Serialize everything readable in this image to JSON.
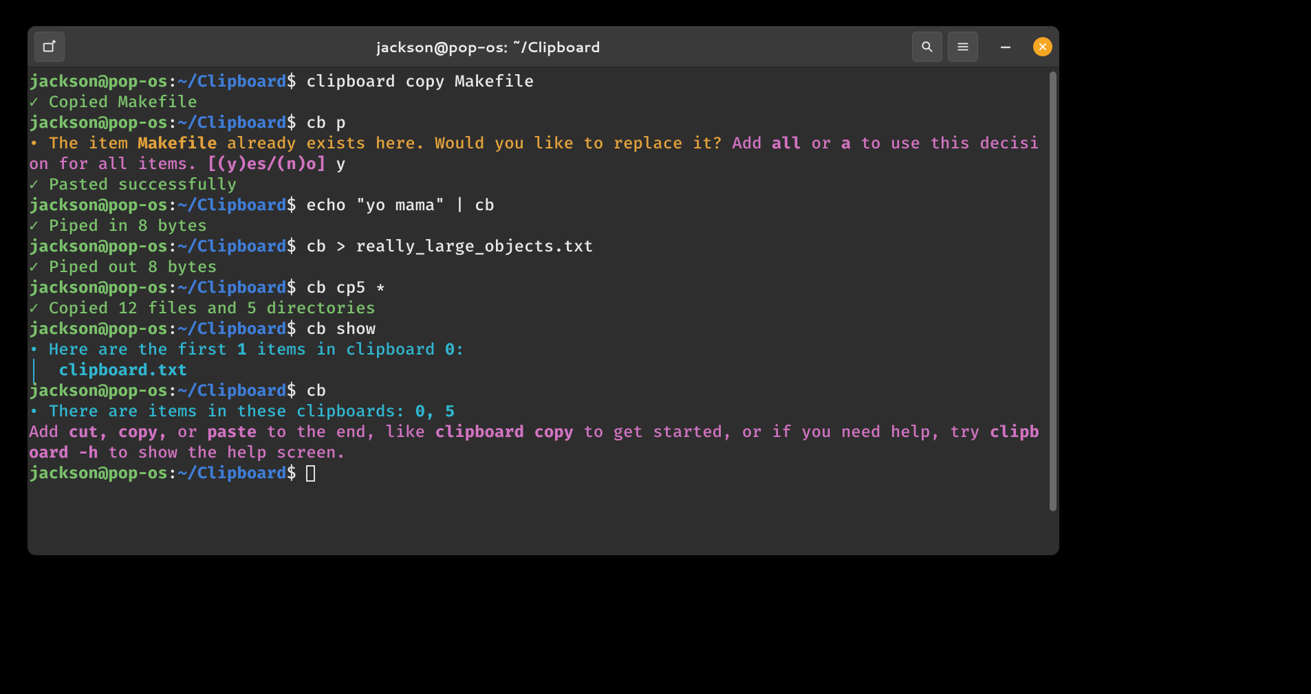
{
  "window": {
    "title": "jackson@pop-os: ~/Clipboard"
  },
  "prompt": {
    "user_host": "jackson@pop-os",
    "sep": ":",
    "cwd": "~/Clipboard",
    "sigil": "$"
  },
  "cmd": {
    "c1": "clipboard copy Makefile",
    "c2": "cb p",
    "c3": "echo \"yo mama\" | cb",
    "c4": "cb > really_large_objects.txt",
    "c5": "cb cp5 *",
    "c6": "cb show",
    "c7": "cb"
  },
  "out": {
    "o1_check": "✓ ",
    "o1_text": "Copied Makefile",
    "o2_bullet": "• ",
    "o2_p1": "The item ",
    "o2_item": "Makefile",
    "o2_p2": " already exists here. Would you like to replace it?",
    "o2_p3": " Add ",
    "o2_all": "all",
    "o2_or": " or ",
    "o2_a": "a",
    "o2_p4": " to use this decision for all items. ",
    "o2_opts": "[(y)es/(n)o]",
    "o2_ans": " y",
    "o3_check": "✓ ",
    "o3_text": "Pasted successfully",
    "o4_check": "✓ ",
    "o4_text": "Piped in 8 bytes",
    "o5_check": "✓ ",
    "o5_text": "Piped out 8 bytes",
    "o6_check": "✓ ",
    "o6_text": "Copied 12 files and 5 directories",
    "o7_bullet": "• ",
    "o7_p1": "Here are the first ",
    "o7_n": "1",
    "o7_p2": " items in clipboard ",
    "o7_cb": "0",
    "o7_p3": ":",
    "o7_bar": "│  ",
    "o7_file": "clipboard.txt",
    "o8_bullet": "• ",
    "o8_p1": "There are items in these clipboards: ",
    "o8_nums": "0, 5",
    "o9_p1": "Add ",
    "o9_cut": "cut",
    "o9_c1": ", ",
    "o9_copy": "copy",
    "o9_c2": ", ",
    "o9_or": "or ",
    "o9_paste": "paste",
    "o9_p2": " to the end, like ",
    "o9_ex": "clipboard copy",
    "o9_p3": " to get started, or if you need help, try ",
    "o9_h": "clipboard -h",
    "o9_p4": " to show the help screen."
  }
}
